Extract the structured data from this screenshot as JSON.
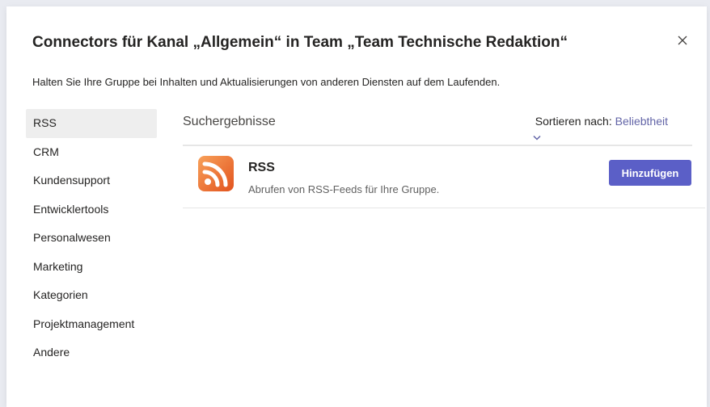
{
  "dialog": {
    "title": "Connectors für Kanal „Allgemein“ in Team „Team Technische Redaktion“",
    "subtitle": "Halten Sie Ihre Gruppe bei Inhalten und Aktualisierungen von anderen Diensten auf dem Laufenden.",
    "close_icon": "close-icon"
  },
  "sidebar": {
    "items": [
      {
        "label": "RSS",
        "active": true
      },
      {
        "label": "CRM"
      },
      {
        "label": "Kundensupport"
      },
      {
        "label": "Entwicklertools"
      },
      {
        "label": "Personalwesen"
      },
      {
        "label": "Marketing"
      },
      {
        "label": "Kategorien"
      },
      {
        "label": "Projektmanagement"
      },
      {
        "label": "Andere"
      }
    ]
  },
  "main": {
    "results_title": "Suchergebnisse",
    "sort_label": "Sortieren nach:",
    "sort_value": "Beliebtheit",
    "sort_icon": "chevron-down-icon",
    "connectors": [
      {
        "name": "RSS",
        "description": "Abrufen von RSS-Feeds für Ihre Gruppe.",
        "icon": "rss-icon",
        "button_label": "Hinzufügen"
      }
    ]
  },
  "colors": {
    "accent": "#5b5fc7",
    "link": "#6264a7",
    "rss_orange": "#f26522",
    "background": "#e9ebf1"
  }
}
